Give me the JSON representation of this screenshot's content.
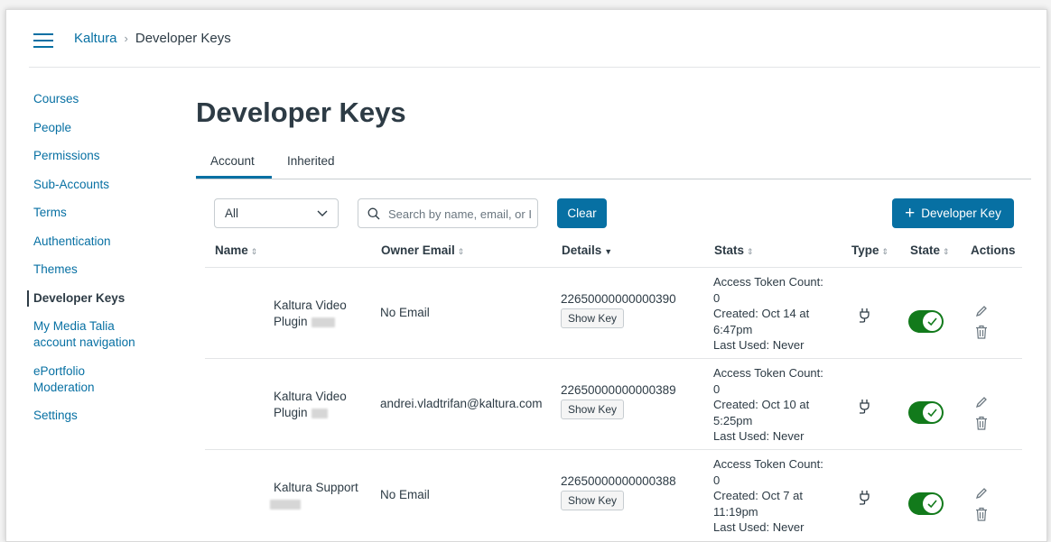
{
  "header": {
    "breadcrumb": [
      "Kaltura",
      "Developer Keys"
    ]
  },
  "sidebar": {
    "items": [
      {
        "label": "Courses"
      },
      {
        "label": "People"
      },
      {
        "label": "Permissions"
      },
      {
        "label": "Sub-Accounts"
      },
      {
        "label": "Terms"
      },
      {
        "label": "Authentication"
      },
      {
        "label": "Themes"
      },
      {
        "label": "Developer Keys",
        "active": true
      },
      {
        "label": "My Media Talia account navigation"
      },
      {
        "label": "ePortfolio Moderation"
      },
      {
        "label": "Settings"
      }
    ]
  },
  "main": {
    "title": "Developer Keys",
    "tabs": [
      {
        "label": "Account",
        "selected": true
      },
      {
        "label": "Inherited"
      }
    ],
    "filter": {
      "value": "All"
    },
    "search": {
      "placeholder": "Search by name, email, or ID"
    },
    "clear_label": "Clear",
    "add_label": "Developer Key",
    "columns": [
      "Name",
      "Owner Email",
      "Details",
      "Stats",
      "Type",
      "State",
      "Actions"
    ],
    "show_key_label": "Show Key",
    "rows": [
      {
        "name_line1": "Kaltura Video",
        "name_line2": "Plugin",
        "email": "No Email",
        "id": "22650000000000390",
        "stats": [
          "Access Token Count:",
          "0",
          "Created: Oct 14 at",
          "6:47pm",
          "Last Used: Never"
        ]
      },
      {
        "name_line1": "Kaltura Video",
        "name_line2": "Plugin",
        "email": "andrei.vladtrifan@kaltura.com",
        "id": "22650000000000389",
        "stats": [
          "Access Token Count:",
          "0",
          "Created: Oct 10 at",
          "5:25pm",
          "Last Used: Never"
        ]
      },
      {
        "name_line1": "Kaltura Support",
        "name_line2": "",
        "email": "No Email",
        "id": "22650000000000388",
        "stats": [
          "Access Token Count:",
          "0",
          "Created: Oct 7 at",
          "11:19pm",
          "Last Used: Never"
        ]
      }
    ]
  },
  "colors": {
    "accent": "#0770a3",
    "toggle_on": "#127a1b",
    "text": "#2d3b45"
  },
  "icons": {
    "menu": "hamburger-icon",
    "search": "search-icon",
    "filter": "chevron-down-icon",
    "type": "plug-icon",
    "state": "check-icon",
    "edit": "pencil-icon",
    "delete": "trash-icon"
  }
}
